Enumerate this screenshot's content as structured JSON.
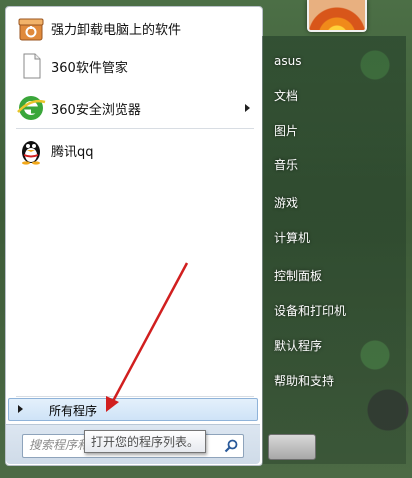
{
  "programs": [
    {
      "label": "强力卸载电脑上的软件",
      "icon": "uninstall-box-icon"
    },
    {
      "label": "360软件管家",
      "icon": "document-icon"
    },
    {
      "label": "360安全浏览器",
      "icon": "browser-e-icon",
      "has_submenu": true
    },
    {
      "label": "腾讯qq",
      "icon": "qq-penguin-icon"
    }
  ],
  "all_programs_label": "所有程序",
  "search": {
    "placeholder": "搜索程序和"
  },
  "tooltip": "打开您的程序列表。",
  "right_items": [
    "asus",
    "文档",
    "图片",
    "音乐",
    "游戏",
    "计算机",
    "控制面板",
    "设备和打印机",
    "默认程序",
    "帮助和支持"
  ],
  "colors": {
    "annotation_arrow": "#d11f1f",
    "all_programs_highlight": "#cfe3f7"
  }
}
